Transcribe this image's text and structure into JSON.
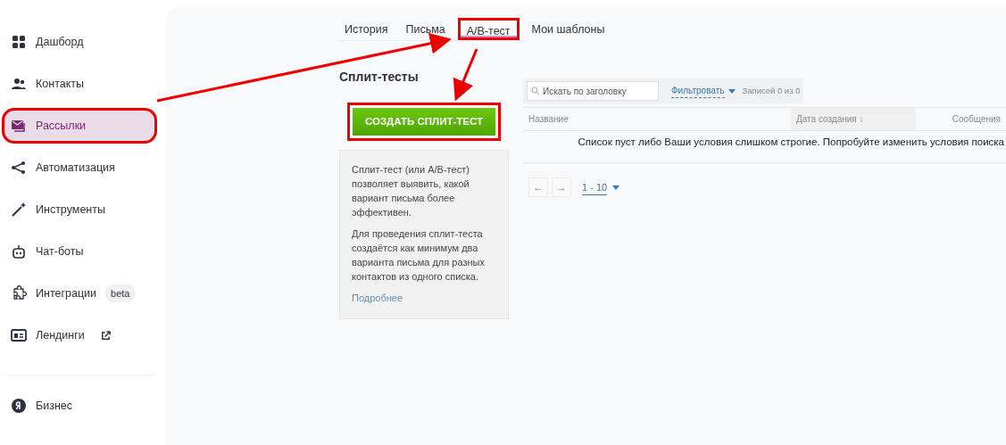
{
  "sidebar": {
    "items": [
      {
        "label": "Дашборд",
        "selected": false,
        "annotated": false
      },
      {
        "label": "Контакты",
        "selected": false,
        "annotated": false
      },
      {
        "label": "Рассылки",
        "selected": true,
        "annotated": true
      },
      {
        "label": "Автоматизация",
        "selected": false,
        "annotated": false
      },
      {
        "label": "Инструменты",
        "selected": false,
        "annotated": false
      },
      {
        "label": "Чат-боты",
        "selected": false,
        "annotated": false
      },
      {
        "label": "Интеграции",
        "selected": false,
        "annotated": false,
        "badge": "beta"
      },
      {
        "label": "Лендинги",
        "selected": false,
        "annotated": false,
        "external": true
      }
    ],
    "bottom_items": [
      {
        "label": "Бизнес"
      }
    ]
  },
  "tabs": [
    {
      "label": "История",
      "selected": false,
      "annotated": false
    },
    {
      "label": "Письма",
      "selected": false,
      "annotated": false
    },
    {
      "label": "A/B-тест",
      "selected": true,
      "annotated": true
    },
    {
      "label": "Мои шаблоны",
      "selected": false,
      "annotated": false
    }
  ],
  "heading": "Сплит-тесты",
  "create_button": {
    "label": "СОЗДАТЬ СПЛИТ-ТЕСТ",
    "annotated": true
  },
  "info": {
    "paragraphs": [
      "Сплит-тест (или A/B-тест) позволяет выявить, какой вариант письма более эффективен.",
      "Для проведения сплит-теста создаётся как минимум два варианта письма для разных контактов из одного списка."
    ],
    "link": "Подробнее"
  },
  "search": {
    "placeholder": "Искать по заголовку"
  },
  "filter": "Фильтровать",
  "records": "Записей 0 из 0",
  "table": {
    "columns": [
      {
        "label": "Название"
      },
      {
        "label": "Дата создания ↓"
      },
      {
        "label": "Сообщения"
      }
    ],
    "empty_message": "Список пуст либо Ваши условия слишком строгие. Попробуйте изменить условия поиска"
  },
  "pagination": {
    "prev": "←",
    "next": "→",
    "range": "1 - 10"
  }
}
